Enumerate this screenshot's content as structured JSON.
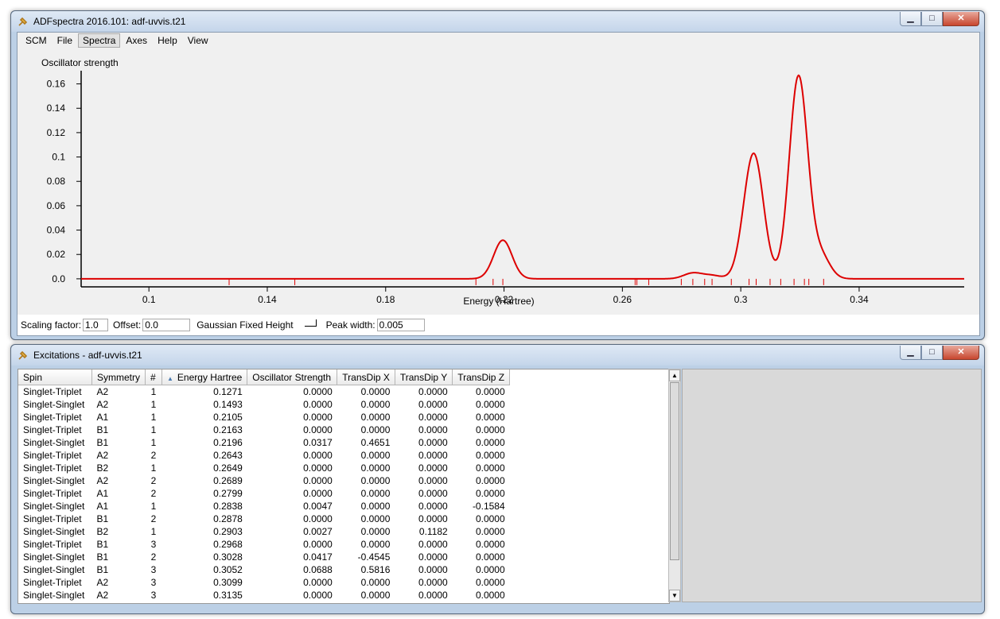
{
  "spectra_window": {
    "title": "ADFspectra 2016.101: adf-uvvis.t21",
    "controls": {
      "minimize": "▁",
      "maximize": "□",
      "close": "✕"
    }
  },
  "menu": [
    "SCM",
    "File",
    "Spectra",
    "Axes",
    "Help",
    "View"
  ],
  "active_menu": "Spectra",
  "chart_data": {
    "type": "line",
    "ylabel": "Oscillator strength",
    "xlabel": "Energy (Hartree)",
    "xlim": [
      0.0771,
      0.3755
    ],
    "ylim": [
      -0.0066,
      0.1656
    ],
    "yticks": [
      "0.16",
      "0.14",
      "0.12",
      "0.1",
      "0.08",
      "0.06",
      "0.04",
      "0.02",
      "0.0"
    ],
    "ytick_values": [
      0.16,
      0.14,
      0.12,
      0.1,
      0.08,
      0.06,
      0.04,
      0.02,
      0.0
    ],
    "xticks": [
      "0.1",
      "0.14",
      "0.18",
      "0.22",
      "0.26",
      "0.3",
      "0.34"
    ],
    "xtick_values": [
      0.1,
      0.14,
      0.18,
      0.22,
      0.26,
      0.3,
      0.34
    ],
    "peak_width": 0.005,
    "line_color": "#dd0000",
    "grid": false,
    "excitation_markers": [
      0.1271,
      0.1493,
      0.2105,
      0.2163,
      0.2196,
      0.2643,
      0.2649,
      0.2689,
      0.2799,
      0.2838,
      0.2878,
      0.2903,
      0.2968,
      0.3028,
      0.3052,
      0.3099,
      0.3135,
      0.318,
      0.3215,
      0.323,
      0.328
    ],
    "series": [
      {
        "peaks": [
          {
            "e": 0.2196,
            "h": 0.0317
          },
          {
            "e": 0.2838,
            "h": 0.0047
          },
          {
            "e": 0.2903,
            "h": 0.0027
          },
          {
            "e": 0.3028,
            "h": 0.0417
          },
          {
            "e": 0.3052,
            "h": 0.0688
          },
          {
            "e": 0.3195,
            "h": 0.166
          },
          {
            "e": 0.327,
            "h": 0.019
          }
        ]
      }
    ]
  },
  "controls_bar": {
    "scaling_label": "Scaling factor:",
    "scaling_value": "1.0",
    "offset_label": "Offset:",
    "offset_value": "0.0",
    "gaussian_label": "Gaussian Fixed Height",
    "peak_label": "Peak width:",
    "peak_value": "0.005"
  },
  "excitations_window": {
    "title": "Excitations - adf-uvvis.t21"
  },
  "table": {
    "columns": [
      "Spin",
      "Symmetry",
      "#",
      "Energy Hartree",
      "Oscillator Strength",
      "TransDip X",
      "TransDip Y",
      "TransDip Z"
    ],
    "sort_indicator": "▲",
    "rows": [
      [
        "Singlet-Triplet",
        "A2",
        "1",
        "0.1271",
        "0.0000",
        "0.0000",
        "0.0000",
        "0.0000"
      ],
      [
        "Singlet-Singlet",
        "A2",
        "1",
        "0.1493",
        "0.0000",
        "0.0000",
        "0.0000",
        "0.0000"
      ],
      [
        "Singlet-Triplet",
        "A1",
        "1",
        "0.2105",
        "0.0000",
        "0.0000",
        "0.0000",
        "0.0000"
      ],
      [
        "Singlet-Triplet",
        "B1",
        "1",
        "0.2163",
        "0.0000",
        "0.0000",
        "0.0000",
        "0.0000"
      ],
      [
        "Singlet-Singlet",
        "B1",
        "1",
        "0.2196",
        "0.0317",
        "0.4651",
        "0.0000",
        "0.0000"
      ],
      [
        "Singlet-Triplet",
        "A2",
        "2",
        "0.2643",
        "0.0000",
        "0.0000",
        "0.0000",
        "0.0000"
      ],
      [
        "Singlet-Triplet",
        "B2",
        "1",
        "0.2649",
        "0.0000",
        "0.0000",
        "0.0000",
        "0.0000"
      ],
      [
        "Singlet-Singlet",
        "A2",
        "2",
        "0.2689",
        "0.0000",
        "0.0000",
        "0.0000",
        "0.0000"
      ],
      [
        "Singlet-Triplet",
        "A1",
        "2",
        "0.2799",
        "0.0000",
        "0.0000",
        "0.0000",
        "0.0000"
      ],
      [
        "Singlet-Singlet",
        "A1",
        "1",
        "0.2838",
        "0.0047",
        "0.0000",
        "0.0000",
        "-0.1584"
      ],
      [
        "Singlet-Triplet",
        "B1",
        "2",
        "0.2878",
        "0.0000",
        "0.0000",
        "0.0000",
        "0.0000"
      ],
      [
        "Singlet-Singlet",
        "B2",
        "1",
        "0.2903",
        "0.0027",
        "0.0000",
        "0.1182",
        "0.0000"
      ],
      [
        "Singlet-Triplet",
        "B1",
        "3",
        "0.2968",
        "0.0000",
        "0.0000",
        "0.0000",
        "0.0000"
      ],
      [
        "Singlet-Singlet",
        "B1",
        "2",
        "0.3028",
        "0.0417",
        "-0.4545",
        "0.0000",
        "0.0000"
      ],
      [
        "Singlet-Singlet",
        "B1",
        "3",
        "0.3052",
        "0.0688",
        "0.5816",
        "0.0000",
        "0.0000"
      ],
      [
        "Singlet-Triplet",
        "A2",
        "3",
        "0.3099",
        "0.0000",
        "0.0000",
        "0.0000",
        "0.0000"
      ],
      [
        "Singlet-Singlet",
        "A2",
        "3",
        "0.3135",
        "0.0000",
        "0.0000",
        "0.0000",
        "0.0000"
      ]
    ]
  },
  "scroll": {
    "up": "▲",
    "down": "▼"
  }
}
